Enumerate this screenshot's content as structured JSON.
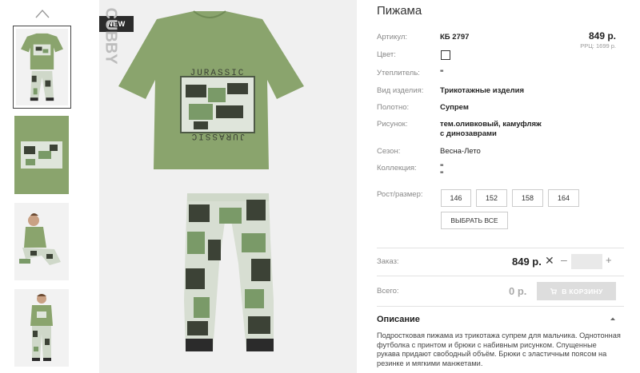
{
  "product": {
    "title": "Пижама",
    "badge": "NEW",
    "brand": "CUBBY",
    "print_text": "JURASSIC"
  },
  "price": {
    "main": "849 р.",
    "rrp": "РРЦ: 1699 р."
  },
  "attributes": [
    {
      "label": "Артикул:",
      "value": "КБ 2797"
    },
    {
      "label": "Цвет:",
      "value": ""
    },
    {
      "label": "Утеплитель:",
      "value": "\""
    },
    {
      "label": "Вид изделия:",
      "value": "Трикотажные изделия"
    },
    {
      "label": "Полотно:",
      "value": "Супрем"
    },
    {
      "label": "Рисунок:",
      "value": "тем.оливковый, камуфляж\nс динозаврами"
    },
    {
      "label": "Сезон:",
      "value": "Весна-Лето"
    },
    {
      "label": "Коллекция:",
      "value": "\"\n\""
    },
    {
      "label": "Рост/размер:",
      "value": ""
    }
  ],
  "sizes": [
    "146",
    "152",
    "158",
    "164"
  ],
  "select_all_label": "ВЫБРАТЬ ВСЕ",
  "order": {
    "label": "Заказ:",
    "price": "849 р.",
    "remove": "✕",
    "minus": "–",
    "plus": "+",
    "qty_value": ""
  },
  "total": {
    "label": "Всего:",
    "price": "0 р.",
    "cart_button": "В КОРЗИНУ"
  },
  "description": {
    "title": "Описание",
    "text": "Подростковая пижама из трикотажа супрем для мальчика. Однотонная футболка с принтом и брюки с набивным рисунком. Спущенные рукава придают свободный объём. Брюки с эластичным поясом на резинке и мягкими манжетами."
  },
  "colors": {
    "olive": "#8aa46d",
    "camo_dark": "#3c4236",
    "camo_mid": "#7a9a68",
    "camo_light": "#dfe5db",
    "badge_bg": "#2b2b2b",
    "cart_btn": "#dddddd"
  },
  "icons": [
    "chevron-up-icon",
    "close-icon",
    "cart-icon",
    "chevron-up-small-icon"
  ]
}
